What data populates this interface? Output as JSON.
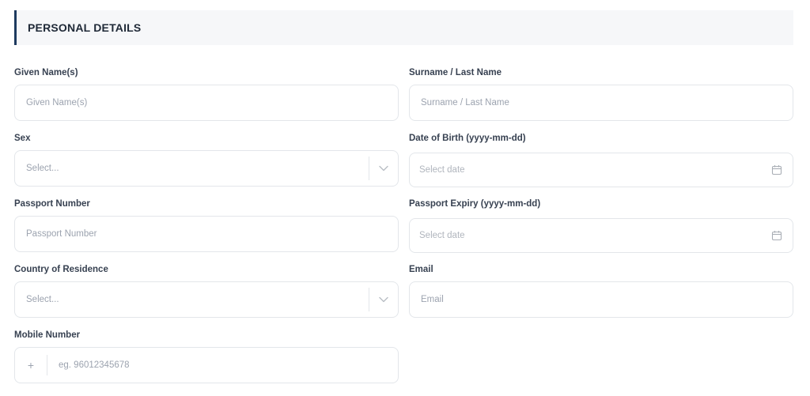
{
  "section": {
    "title": "PERSONAL DETAILS"
  },
  "fields": {
    "given_name": {
      "label": "Given Name(s)",
      "placeholder": "Given Name(s)"
    },
    "surname": {
      "label": "Surname / Last Name",
      "placeholder": "Surname / Last Name"
    },
    "sex": {
      "label": "Sex",
      "value": "Select...",
      "icon": "chevron-down-icon"
    },
    "dob": {
      "label": "Date of Birth (yyyy-mm-dd)",
      "value": "Select date",
      "icon": "calendar-icon"
    },
    "passport_number": {
      "label": "Passport Number",
      "placeholder": "Passport Number"
    },
    "passport_expiry": {
      "label": "Passport Expiry (yyyy-mm-dd)",
      "value": "Select date",
      "icon": "calendar-icon"
    },
    "country": {
      "label": "Country of Residence",
      "value": "Select...",
      "icon": "chevron-down-icon"
    },
    "email": {
      "label": "Email",
      "placeholder": "Email"
    },
    "mobile": {
      "label": "Mobile Number",
      "prefix": "+",
      "placeholder": "eg. 96012345678"
    }
  },
  "colors": {
    "accent": "#1e3a5f",
    "header_bg": "#f6f7f9",
    "border": "#e3e6ea",
    "placeholder": "#9ca3af"
  }
}
